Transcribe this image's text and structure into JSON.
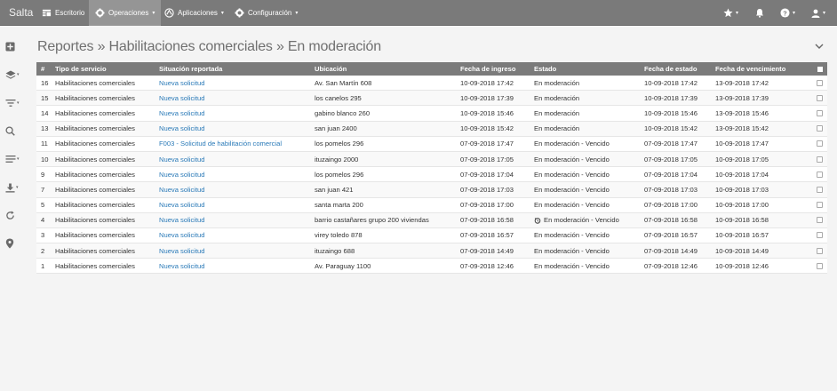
{
  "nav": {
    "brand": "Salta",
    "items": [
      {
        "label": "Escritorio",
        "icon": "desktop-icon"
      },
      {
        "label": "Operaciones",
        "icon": "gear-icon",
        "caret": "▾"
      },
      {
        "label": "Aplicaciones",
        "icon": "apps-icon",
        "caret": "▾"
      },
      {
        "label": "Configuración",
        "icon": "settings-icon",
        "caret": "▾"
      }
    ],
    "right": [
      {
        "icon": "star-icon",
        "caret": "▾"
      },
      {
        "icon": "bell-icon"
      },
      {
        "icon": "help-icon",
        "caret": "▾"
      },
      {
        "icon": "user-icon",
        "caret": "▾"
      }
    ]
  },
  "sidebar": [
    "add-icon",
    "layers-icon",
    "filter-icon",
    "search-icon",
    "list-icon",
    "download-icon",
    "refresh-icon",
    "map-marker-icon"
  ],
  "page": {
    "title": "Reportes » Habilitaciones comerciales » En moderación"
  },
  "table": {
    "headers": {
      "num": "#",
      "tipo": "Tipo de servicio",
      "situacion": "Situación reportada",
      "ubicacion": "Ubicación",
      "ingreso": "Fecha de ingreso",
      "estado": "Estado",
      "fecha_estado": "Fecha de estado",
      "vencimiento": "Fecha de vencimiento"
    },
    "rows": [
      {
        "num": "16",
        "tipo": "Habilitaciones comerciales",
        "situacion": "Nueva solicitud",
        "ubicacion": "Av. San Martín 608",
        "ingreso": "10-09-2018 17:42",
        "estado": "En moderación",
        "fecha_estado": "10-09-2018 17:42",
        "vencimiento": "13-09-2018 17:42"
      },
      {
        "num": "15",
        "tipo": "Habilitaciones comerciales",
        "situacion": "Nueva solicitud",
        "ubicacion": "los canelos 295",
        "ingreso": "10-09-2018 17:39",
        "estado": "En moderación",
        "fecha_estado": "10-09-2018 17:39",
        "vencimiento": "13-09-2018 17:39"
      },
      {
        "num": "14",
        "tipo": "Habilitaciones comerciales",
        "situacion": "Nueva solicitud",
        "ubicacion": "gabino blanco 260",
        "ingreso": "10-09-2018 15:46",
        "estado": "En moderación",
        "fecha_estado": "10-09-2018 15:46",
        "vencimiento": "13-09-2018 15:46"
      },
      {
        "num": "13",
        "tipo": "Habilitaciones comerciales",
        "situacion": "Nueva solicitud",
        "ubicacion": "san juan 2400",
        "ingreso": "10-09-2018 15:42",
        "estado": "En moderación",
        "fecha_estado": "10-09-2018 15:42",
        "vencimiento": "13-09-2018 15:42"
      },
      {
        "num": "11",
        "tipo": "Habilitaciones comerciales",
        "situacion": "F003 - Solicitud de habilitación comercial",
        "ubicacion": "los pomelos 296",
        "ingreso": "07-09-2018 17:47",
        "estado": "En moderación - Vencido",
        "fecha_estado": "07-09-2018 17:47",
        "vencimiento": "10-09-2018 17:47"
      },
      {
        "num": "10",
        "tipo": "Habilitaciones comerciales",
        "situacion": "Nueva solicitud",
        "ubicacion": "ituzaingo 2000",
        "ingreso": "07-09-2018 17:05",
        "estado": "En moderación - Vencido",
        "fecha_estado": "07-09-2018 17:05",
        "vencimiento": "10-09-2018 17:05"
      },
      {
        "num": "9",
        "tipo": "Habilitaciones comerciales",
        "situacion": "Nueva solicitud",
        "ubicacion": "los pomelos 296",
        "ingreso": "07-09-2018 17:04",
        "estado": "En moderación - Vencido",
        "fecha_estado": "07-09-2018 17:04",
        "vencimiento": "10-09-2018 17:04"
      },
      {
        "num": "7",
        "tipo": "Habilitaciones comerciales",
        "situacion": "Nueva solicitud",
        "ubicacion": "san juan 421",
        "ingreso": "07-09-2018 17:03",
        "estado": "En moderación - Vencido",
        "fecha_estado": "07-09-2018 17:03",
        "vencimiento": "10-09-2018 17:03"
      },
      {
        "num": "5",
        "tipo": "Habilitaciones comerciales",
        "situacion": "Nueva solicitud",
        "ubicacion": "santa marta 200",
        "ingreso": "07-09-2018 17:00",
        "estado": "En moderación - Vencido",
        "fecha_estado": "07-09-2018 17:00",
        "vencimiento": "10-09-2018 17:00"
      },
      {
        "num": "4",
        "tipo": "Habilitaciones comerciales",
        "situacion": "Nueva solicitud",
        "ubicacion": "barrio castañares grupo 200 viviendas",
        "ingreso": "07-09-2018 16:58",
        "estado": "En moderación - Vencido",
        "state_icon": "history-icon",
        "fecha_estado": "07-09-2018 16:58",
        "vencimiento": "10-09-2018 16:58"
      },
      {
        "num": "3",
        "tipo": "Habilitaciones comerciales",
        "situacion": "Nueva solicitud",
        "ubicacion": "virey toledo 878",
        "ingreso": "07-09-2018 16:57",
        "estado": "En moderación - Vencido",
        "fecha_estado": "07-09-2018 16:57",
        "vencimiento": "10-09-2018 16:57"
      },
      {
        "num": "2",
        "tipo": "Habilitaciones comerciales",
        "situacion": "Nueva solicitud",
        "ubicacion": "ituzaingo 688",
        "ingreso": "07-09-2018 14:49",
        "estado": "En moderación - Vencido",
        "fecha_estado": "07-09-2018 14:49",
        "vencimiento": "10-09-2018 14:49"
      },
      {
        "num": "1",
        "tipo": "Habilitaciones comerciales",
        "situacion": "Nueva solicitud",
        "ubicacion": "Av. Paraguay 1100",
        "ingreso": "07-09-2018 12:46",
        "estado": "En moderación - Vencido",
        "fecha_estado": "07-09-2018 12:46",
        "vencimiento": "10-09-2018 12:46"
      }
    ]
  }
}
